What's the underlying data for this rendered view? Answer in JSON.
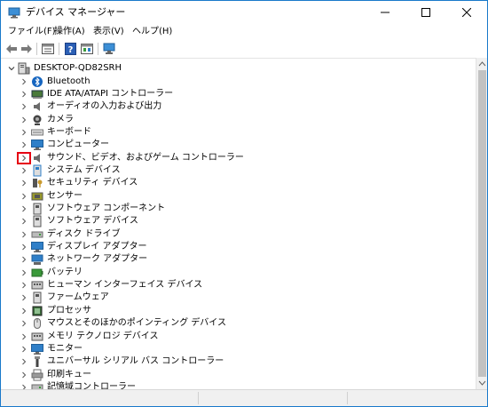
{
  "window": {
    "title": "デバイス マネージャー",
    "minimize_glyph": "—",
    "maximize_glyph": "☐",
    "close_glyph": "✕"
  },
  "menu": [
    "ファイル(F)",
    "操作(A)",
    "表示(V)",
    "ヘルプ(H)"
  ],
  "toolbar": {
    "icons": [
      "back-arrow-icon",
      "forward-arrow-icon",
      "properties-icon",
      "help-icon",
      "device-view-icon",
      "monitor-scan-icon"
    ]
  },
  "tree": {
    "root": "DESKTOP-QD82SRH",
    "items": [
      {
        "label": "Bluetooth",
        "icon": "bluetooth-icon",
        "color": "#1565c0"
      },
      {
        "label": "IDE ATA/ATAPI コントローラー",
        "icon": "ide-controller-icon",
        "color": "#4a7a3a"
      },
      {
        "label": "オーディオの入力および出力",
        "icon": "speaker-icon",
        "color": "#6b6b6b"
      },
      {
        "label": "カメラ",
        "icon": "camera-icon",
        "color": "#444444"
      },
      {
        "label": "キーボード",
        "icon": "keyboard-icon",
        "color": "#7a7a7a"
      },
      {
        "label": "コンピューター",
        "icon": "computer-icon",
        "color": "#2f7fc8"
      },
      {
        "label": "サウンド、ビデオ、およびゲーム コントローラー",
        "icon": "sound-icon",
        "color": "#6b6b6b"
      },
      {
        "label": "システム デバイス",
        "icon": "system-device-icon",
        "color": "#2f7fc8"
      },
      {
        "label": "セキュリティ デバイス",
        "icon": "security-key-icon",
        "color": "#c99a2e"
      },
      {
        "label": "センサー",
        "icon": "sensor-icon",
        "color": "#9a9a2a"
      },
      {
        "label": "ソフトウェア コンポーネント",
        "icon": "software-component-icon",
        "color": "#555555"
      },
      {
        "label": "ソフトウェア デバイス",
        "icon": "software-device-icon",
        "color": "#555555"
      },
      {
        "label": "ディスク ドライブ",
        "icon": "disk-drive-icon",
        "color": "#6b6b6b"
      },
      {
        "label": "ディスプレイ アダプター",
        "icon": "display-adapter-icon",
        "color": "#2f7fc8"
      },
      {
        "label": "ネットワーク アダプター",
        "icon": "network-adapter-icon",
        "color": "#2f7fc8"
      },
      {
        "label": "バッテリ",
        "icon": "battery-icon",
        "color": "#3a9a3a"
      },
      {
        "label": "ヒューマン インターフェイス デバイス",
        "icon": "hid-icon",
        "color": "#555555"
      },
      {
        "label": "ファームウェア",
        "icon": "firmware-icon",
        "color": "#555555"
      },
      {
        "label": "プロセッサ",
        "icon": "processor-icon",
        "color": "#3a6a3a"
      },
      {
        "label": "マウスとそのほかのポインティング デバイス",
        "icon": "mouse-icon",
        "color": "#6b6b6b"
      },
      {
        "label": "メモリ テクノロジ デバイス",
        "icon": "memory-icon",
        "color": "#555555"
      },
      {
        "label": "モニター",
        "icon": "monitor-icon",
        "color": "#2f7fc8"
      },
      {
        "label": "ユニバーサル シリアル バス コントローラー",
        "icon": "usb-icon",
        "color": "#444444"
      },
      {
        "label": "印刷キュー",
        "icon": "printer-icon",
        "color": "#6b6b6b"
      },
      {
        "label": "記憶域コントローラー",
        "icon": "storage-controller-icon",
        "color": "#6b6b6b"
      }
    ],
    "highlighted_index": 6,
    "highlight_color": "#e60012"
  }
}
